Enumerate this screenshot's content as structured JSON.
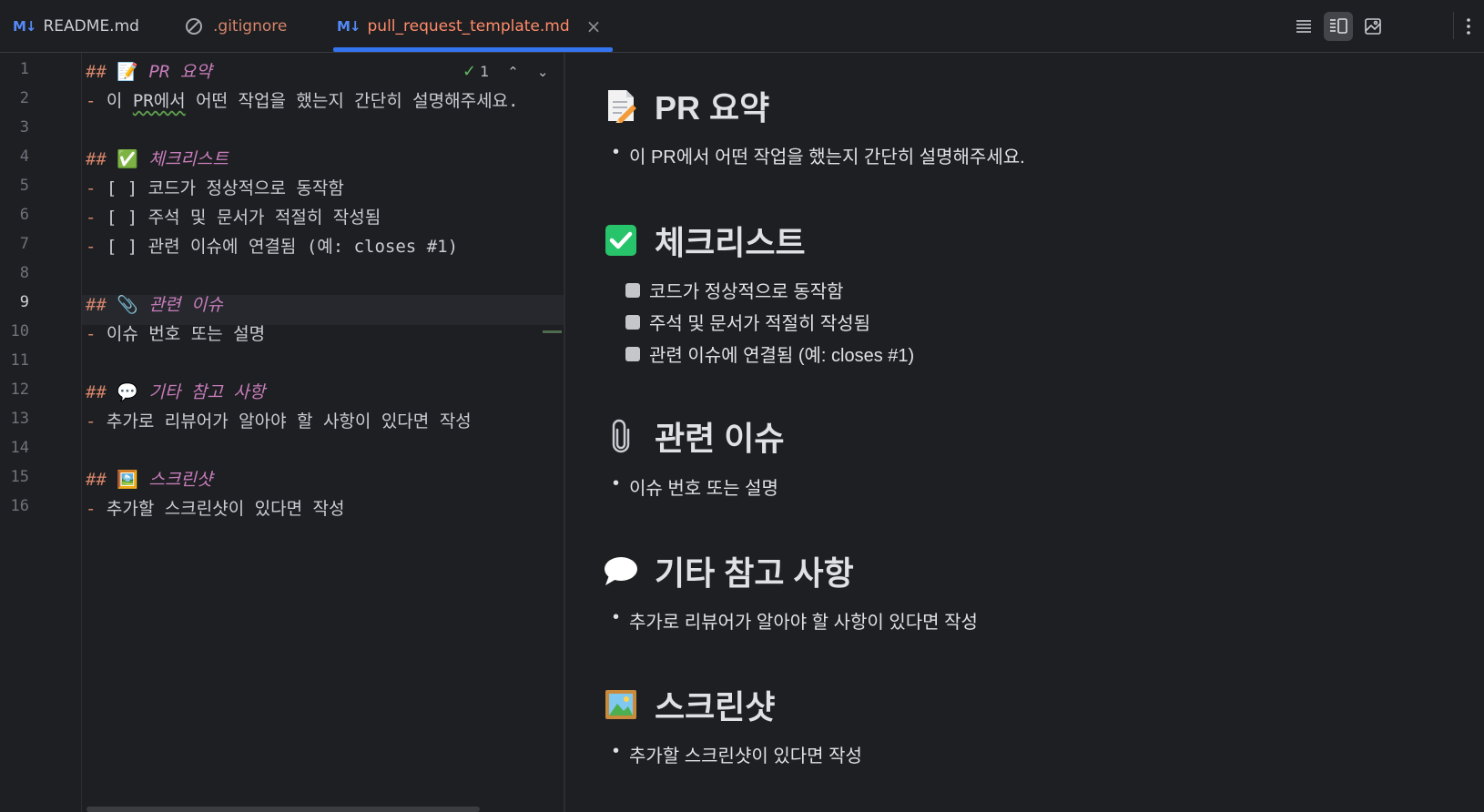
{
  "tabs": [
    {
      "badge": "M↓",
      "label": "README.md"
    },
    {
      "label": ".gitignore"
    },
    {
      "badge": "M↓",
      "label": "pull_request_template.md",
      "close": "×"
    }
  ],
  "inspection": {
    "count": "1"
  },
  "line_numbers": [
    "1",
    "2",
    "3",
    "4",
    "5",
    "6",
    "7",
    "8",
    "9",
    "10",
    "11",
    "12",
    "13",
    "14",
    "15",
    "16"
  ],
  "current_line": "9",
  "code": {
    "l1_hash": "##",
    "l1_text": "PR 요약",
    "l2_dash": "-",
    "l2_a": "이 ",
    "l2_b": "PR에서",
    "l2_c": " 어떤 작업을 했는지 간단히 설명해주세요.",
    "l4_hash": "##",
    "l4_text": "체크리스트",
    "l5_dash": "-",
    "l5_text": "[ ] 코드가 정상적으로 동작함",
    "l6_dash": "-",
    "l6_text": "[ ] 주석 및 문서가 적절히 작성됨",
    "l7_dash": "-",
    "l7_text": "[ ] 관련 이슈에 연결됨 (예: closes #1)",
    "l9_hash": "##",
    "l9_text": "관련 이슈",
    "l10_dash": "-",
    "l10_text": "이슈 번호 또는 설명",
    "l12_hash": "##",
    "l12_text": "기타 참고 사항",
    "l13_dash": "-",
    "l13_text": "추가로 리뷰어가 알아야 할 사항이 있다면 작성",
    "l15_hash": "##",
    "l15_text": "스크린샷",
    "l16_dash": "-",
    "l16_text": "추가할 스크린샷이 있다면 작성"
  },
  "preview": {
    "h1": "PR 요약",
    "li1": "이 PR에서 어떤 작업을 했는지 간단히 설명해주세요.",
    "h2": "체크리스트",
    "tasks": [
      "코드가 정상적으로 동작함",
      "주석 및 문서가 적절히 작성됨",
      "관련 이슈에 연결됨 (예: closes #1)"
    ],
    "h3": "관련 이슈",
    "li3": "이슈 번호 또는 설명",
    "h4": "기타 참고 사항",
    "li4": "추가로 리뷰어가 알아야 할 사항이 있다면 작성",
    "h5": "스크린샷",
    "li5": "추가할 스크린샷이 있다면 작성"
  },
  "colors": {
    "accent": "#3574f0",
    "heading": "#c77dbb",
    "markup": "#d5856a",
    "check_green": "#27c46b"
  }
}
